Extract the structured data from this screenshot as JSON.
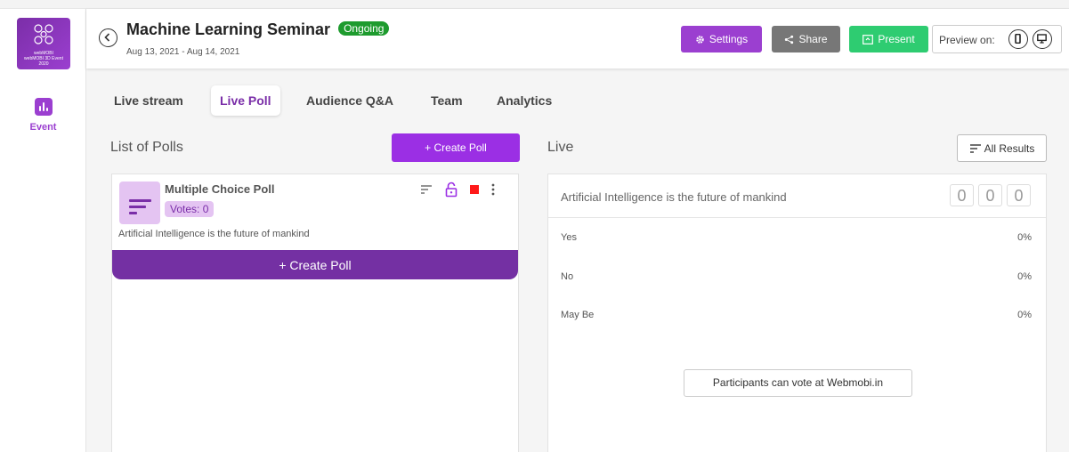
{
  "logo": {
    "line1": "webMOBI",
    "line2": "webMOBI 3D Event",
    "line3": "2020"
  },
  "rail": {
    "event_label": "Event"
  },
  "header": {
    "title": "Machine Learning Seminar",
    "status": "Ongoing",
    "dates": "Aug 13, 2021 - Aug 14, 2021",
    "settings_label": "Settings",
    "share_label": "Share",
    "present_label": "Present",
    "preview_label": "Preview on:"
  },
  "tabs": [
    {
      "label": "Live stream"
    },
    {
      "label": "Live Poll"
    },
    {
      "label": "Audience Q&A"
    },
    {
      "label": "Team"
    },
    {
      "label": "Analytics"
    }
  ],
  "polls": {
    "title": "List of Polls",
    "create_label": "+ Create Poll",
    "card": {
      "type": "Multiple Choice Poll",
      "votes": "Votes: 0",
      "question": "Artificial Intelligence is the future of mankind",
      "create_bar_label": "+ Create Poll"
    }
  },
  "live": {
    "title": "Live",
    "all_results_label": "All Results",
    "question": "Artificial Intelligence is the future of mankind",
    "counters": [
      "0",
      "0",
      "0"
    ],
    "options": [
      {
        "label": "Yes",
        "pct": "0%"
      },
      {
        "label": "No",
        "pct": "0%"
      },
      {
        "label": "May Be",
        "pct": "0%"
      }
    ],
    "participants_note": "Participants can vote at Webmobi.in"
  },
  "colors": {
    "accent": "#9b3fd0",
    "active_tab": "#7a2ea8",
    "ongoing": "#1e9b2e",
    "present": "#2ecc71",
    "share": "#777777"
  }
}
